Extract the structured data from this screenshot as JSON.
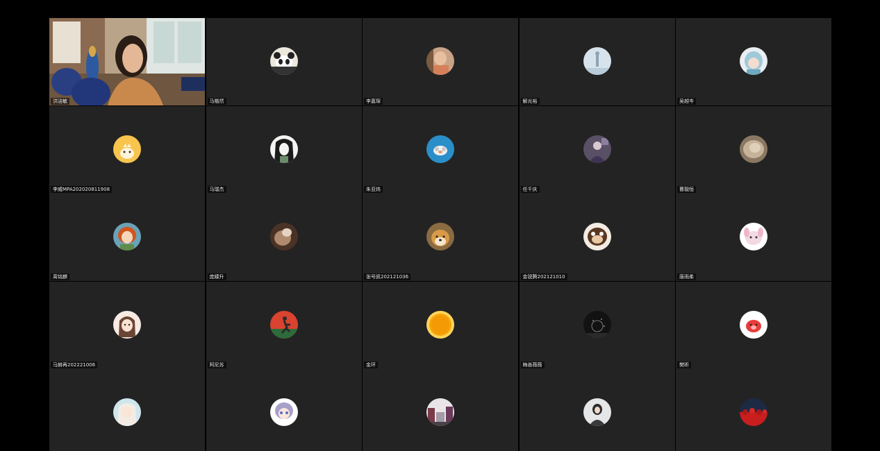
{
  "participants": [
    {
      "name": "洪洁敏",
      "active": true,
      "video": true
    },
    {
      "name": "马楷然",
      "avatar": "panda-avatar"
    },
    {
      "name": "李嘉琛",
      "avatar": "child-photo-avatar"
    },
    {
      "name": "解光裕",
      "avatar": "sky-figure-avatar"
    },
    {
      "name": "吴越岑",
      "avatar": "anime-hood-avatar"
    },
    {
      "name": "李威MPA202020811908",
      "avatar": "yellow-cartoon-avatar"
    },
    {
      "name": "马瑞杰",
      "avatar": "sketch-girl-avatar"
    },
    {
      "name": "朱亚炜",
      "avatar": "blue-animal-avatar"
    },
    {
      "name": "任千庆",
      "avatar": "person-photo-avatar"
    },
    {
      "name": "曹靓恒",
      "avatar": "cat-fur-avatar"
    },
    {
      "name": "周铭麒",
      "avatar": "red-hair-cartoon-avatar"
    },
    {
      "name": "庞緌升",
      "avatar": "brown-photo-avatar"
    },
    {
      "name": "张号凯202121036",
      "avatar": "shiba-dog-avatar"
    },
    {
      "name": "金锐腾202121010",
      "avatar": "brown-animal-avatar"
    },
    {
      "name": "唐雨柔",
      "avatar": "pink-bunny-avatar"
    },
    {
      "name": "马赫再202221006",
      "avatar": "anime-girl-avatar"
    },
    {
      "name": "阿尼苏",
      "avatar": "runner-avatar"
    },
    {
      "name": "金环",
      "avatar": "orange-sun-avatar"
    },
    {
      "name": "梅善薇薇",
      "avatar": "night-sky-avatar"
    },
    {
      "name": "樊昕",
      "avatar": "red-pig-avatar"
    },
    {
      "name": "",
      "avatar": "white-haired-avatar"
    },
    {
      "name": "",
      "avatar": "chibi-girl-avatar"
    },
    {
      "name": "",
      "avatar": "street-scene-avatar"
    },
    {
      "name": "",
      "avatar": "woman-photo-avatar"
    },
    {
      "name": "",
      "avatar": "red-crowd-avatar"
    }
  ],
  "colors": {
    "tile_bg": "#232323",
    "active_border": "#3bd16a",
    "background": "#000000"
  }
}
